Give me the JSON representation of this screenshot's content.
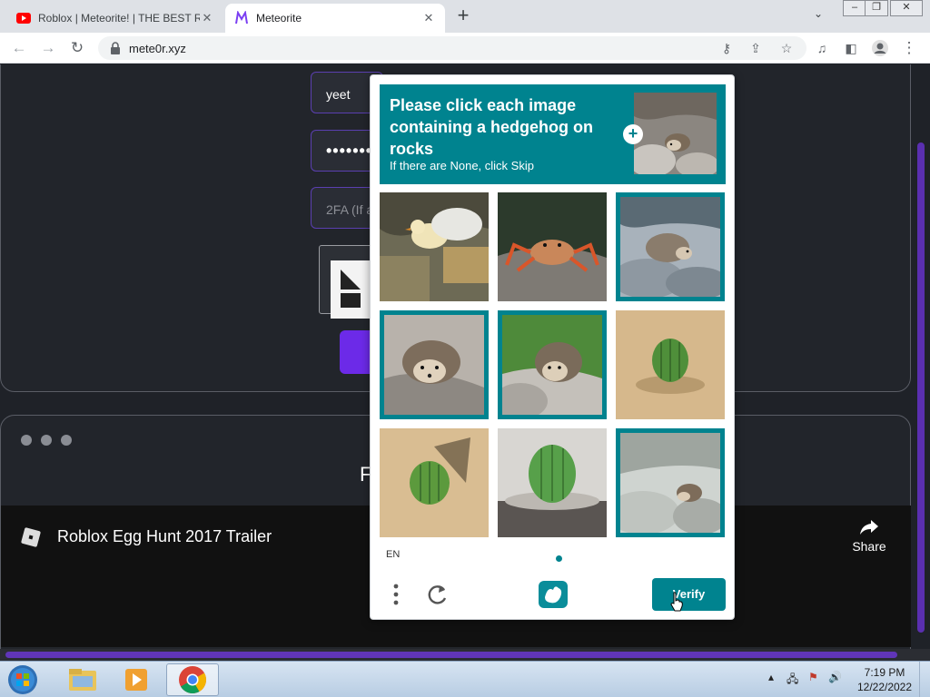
{
  "browser": {
    "tabs": [
      {
        "title": "Roblox | Meteorite! | THE BEST R",
        "active": false,
        "favicon": "youtube-icon"
      },
      {
        "title": "Meteorite",
        "active": true,
        "favicon": "meteorite-icon"
      }
    ],
    "url": "mete0r.xyz"
  },
  "login": {
    "username": "yeet",
    "password_mask": "•••••••",
    "twofa_placeholder": "2FA (If a"
  },
  "card2": {
    "heading_fragment": "F"
  },
  "video": {
    "title": "Roblox Egg Hunt 2017 Trailer",
    "share_label": "Share"
  },
  "captcha": {
    "prompt": "Please click each image containing a hedgehog on rocks",
    "subtext": "If there are None, click Skip",
    "language": "EN",
    "verify_label": "Verify",
    "accent_color": "#00838f",
    "tiles": [
      {
        "subject": "duckling on rocks",
        "selected": false
      },
      {
        "subject": "crab on rock",
        "selected": false
      },
      {
        "subject": "hedgehog on rocks",
        "selected": true
      },
      {
        "subject": "hedgehog on rocks",
        "selected": true
      },
      {
        "subject": "hedgehog on rocks",
        "selected": true
      },
      {
        "subject": "cactus in sand",
        "selected": false
      },
      {
        "subject": "cactus in sand",
        "selected": false
      },
      {
        "subject": "cactus in pot",
        "selected": false
      },
      {
        "subject": "hedgehog on rocks",
        "selected": true
      }
    ]
  },
  "taskbar": {
    "time": "7:19 PM",
    "date": "12/22/2022"
  }
}
